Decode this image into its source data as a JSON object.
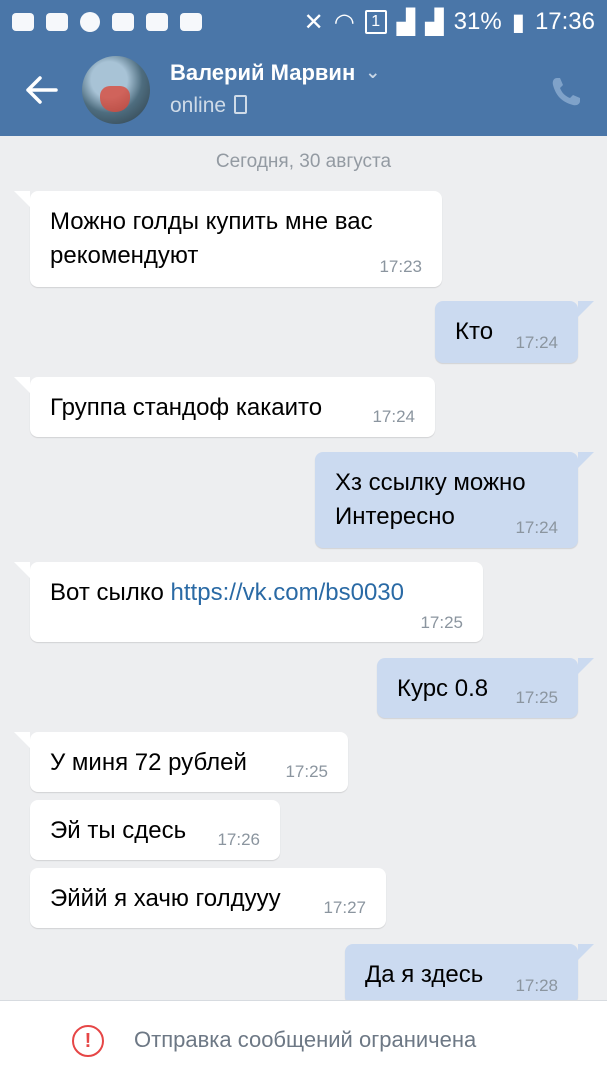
{
  "status_bar": {
    "battery": "31%",
    "time": "17:36",
    "sim": "1"
  },
  "header": {
    "contact_name": "Валерий Марвин",
    "status": "online"
  },
  "chat": {
    "date_separator": "Сегодня, 30 августа",
    "messages": [
      {
        "direction": "in",
        "text": "Можно голды купить мне вас\nрекомендуют",
        "time": "17:23"
      },
      {
        "direction": "out",
        "text": "Кто",
        "time": "17:24"
      },
      {
        "direction": "in",
        "text": "Группа стандоф какаито",
        "time": "17:24"
      },
      {
        "direction": "out",
        "text": "Хз ссылку можно\nИнтересно",
        "time": "17:24"
      },
      {
        "direction": "in",
        "text": "Вот сылко ",
        "link": "https://vk.com/bs0030",
        "time": "17:25"
      },
      {
        "direction": "out",
        "text": "Курс 0.8",
        "time": "17:25"
      },
      {
        "direction": "in",
        "text": "У миня 72 рублей",
        "time": "17:25"
      },
      {
        "direction": "in",
        "text": "Эй ты сдесь",
        "time": "17:26"
      },
      {
        "direction": "in",
        "text": "Эййй я хачю голдууу",
        "time": "17:27"
      },
      {
        "direction": "out",
        "text": "Да я здесь",
        "time": "17:28"
      }
    ]
  },
  "footer": {
    "restriction_text": "Отправка сообщений ограничена"
  },
  "colors": {
    "header_bg": "#4a76a8",
    "chat_bg": "#edeef0",
    "outgoing_bubble": "#cbdaf0",
    "link": "#2a6aa5",
    "warning": "#e64646"
  }
}
